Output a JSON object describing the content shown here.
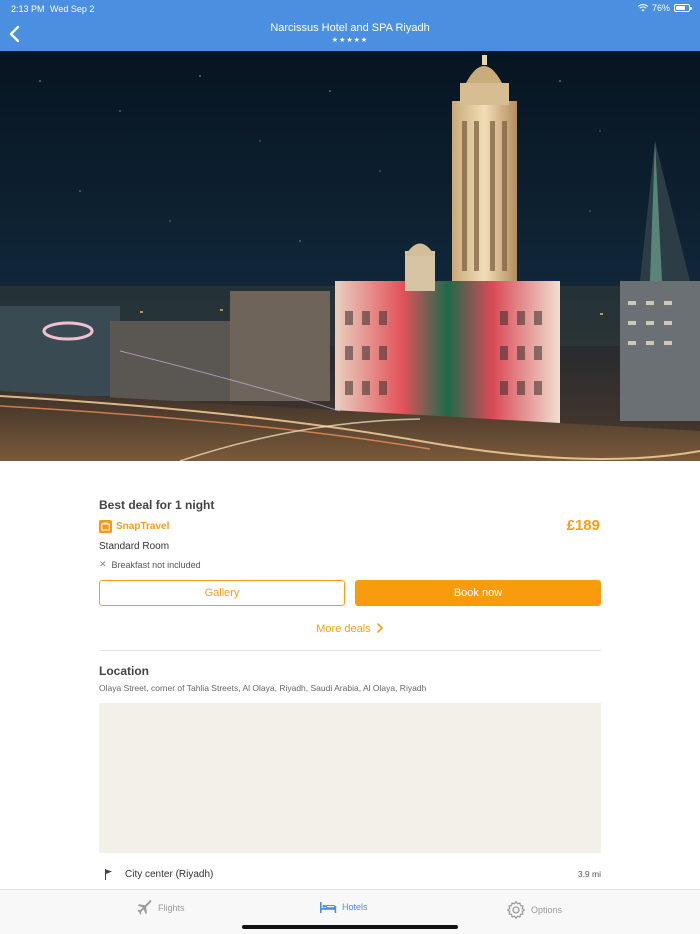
{
  "status_bar": {
    "time": "2:13 PM",
    "date": "Wed Sep 2",
    "battery": "76%",
    "battery_level": 0.76
  },
  "header": {
    "title": "Narcissus Hotel and SPA Riyadh",
    "stars": "★★★★★",
    "star_rating": 5
  },
  "deal": {
    "heading": "Best deal for 1 night",
    "provider": "SnapTravel",
    "price": "£189",
    "room": "Standard Room",
    "breakfast_icon": "x-icon",
    "breakfast": "Breakfast not included",
    "gallery_label": "Gallery",
    "book_label": "Book now",
    "more_deals_label": "More deals"
  },
  "location": {
    "heading": "Location",
    "address": "Olaya Street, corner of Tahlia Streets, Al Olaya, Riyadh, Saudi Arabia, Al Olaya, Riyadh",
    "poi": {
      "icon": "flag-icon",
      "name": "City center (Riyadh)",
      "distance": "3.9 mi"
    }
  },
  "tabs": [
    {
      "label": "Flights",
      "icon": "airplane-icon",
      "active": false
    },
    {
      "label": "Hotels",
      "icon": "bed-icon",
      "active": true
    },
    {
      "label": "Options",
      "icon": "gear-icon",
      "active": false
    }
  ],
  "colors": {
    "header": "#4a8fe0",
    "accent": "#f5a014",
    "book_button": "#f89c0e",
    "map": "#f3f0ea"
  }
}
